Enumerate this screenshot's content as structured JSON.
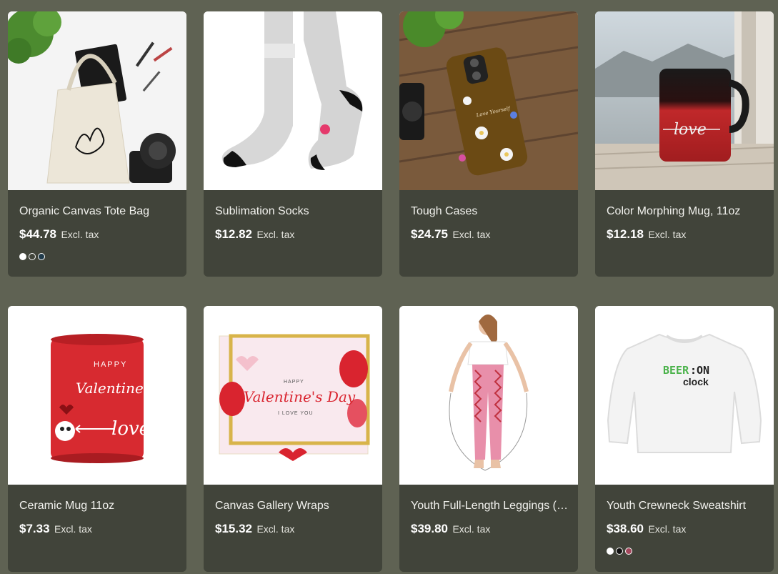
{
  "products": [
    {
      "title": "Organic Canvas Tote Bag",
      "price": "$44.78",
      "tax": "Excl. tax",
      "image_icon": "tote-bag-icon",
      "swatches": [
        "#ffffff",
        "#41443a",
        "#1f3a4a"
      ]
    },
    {
      "title": "Sublimation Socks",
      "price": "$12.82",
      "tax": "Excl. tax",
      "image_icon": "socks-icon",
      "swatches": []
    },
    {
      "title": "Tough Cases",
      "price": "$24.75",
      "tax": "Excl. tax",
      "image_icon": "phone-case-icon",
      "swatches": []
    },
    {
      "title": "Color Morphing Mug, 11oz",
      "price": "$12.18",
      "tax": "Excl. tax",
      "image_icon": "mug-icon",
      "swatches": []
    },
    {
      "title": "Ceramic Mug 11oz",
      "price": "$7.33",
      "tax": "Excl. tax",
      "image_icon": "mug-icon",
      "swatches": []
    },
    {
      "title": "Canvas Gallery Wraps",
      "price": "$15.32",
      "tax": "Excl. tax",
      "image_icon": "canvas-icon",
      "swatches": []
    },
    {
      "title": "Youth Full-Length Leggings (…",
      "price": "$39.80",
      "tax": "Excl. tax",
      "image_icon": "leggings-icon",
      "swatches": []
    },
    {
      "title": "Youth Crewneck Sweatshirt",
      "price": "$38.60",
      "tax": "Excl. tax",
      "image_icon": "sweatshirt-icon",
      "swatches": [
        "#ffffff",
        "#111111",
        "#a3475c"
      ]
    }
  ],
  "image_text": {
    "tote_print": "",
    "mug_morph": "love",
    "case_text": "Love Yourself",
    "ceramic_happy": "HAPPY",
    "ceramic_valentines": "Valentines",
    "ceramic_love": "love",
    "canvas_happy": "HAPPY",
    "canvas_valentine": "Valentine's Day",
    "canvas_iloveyou": "I LOVE YOU",
    "sweat_beer": "BEER",
    "sweat_on": ":ON",
    "sweat_clock": "clock"
  },
  "colors": {
    "page_bg": "#5f6253",
    "card_bg": "#41443a"
  }
}
